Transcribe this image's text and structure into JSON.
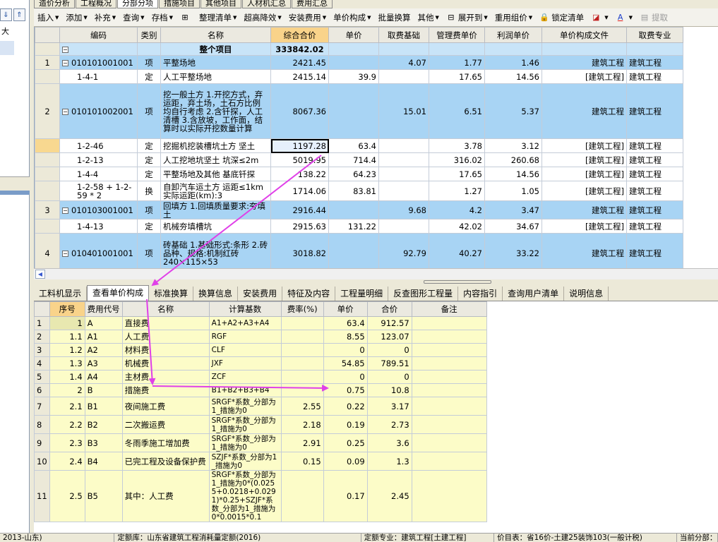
{
  "top_tabs": [
    "造价分析",
    "工程概况",
    "分部分项",
    "措施项目",
    "其他项目",
    "人材机汇总",
    "费用汇总"
  ],
  "left_panel": {
    "label": "大"
  },
  "toolbar": {
    "items": [
      {
        "label": "插入",
        "icon": "",
        "caret": true
      },
      {
        "label": "添加",
        "icon": "",
        "caret": true
      },
      {
        "label": "补充",
        "icon": "",
        "caret": true
      },
      {
        "label": "查询",
        "icon": "",
        "caret": true
      },
      {
        "label": "存档",
        "icon": "",
        "caret": true
      },
      {
        "label": "",
        "icon": "binoculars-icon",
        "caret": false
      },
      {
        "label": "整理清单",
        "icon": "",
        "caret": true
      },
      {
        "label": "超高降效",
        "icon": "",
        "caret": true
      },
      {
        "label": "安装费用",
        "icon": "",
        "caret": true
      },
      {
        "label": "单价构成",
        "icon": "",
        "caret": true
      },
      {
        "label": "批量换算",
        "icon": "",
        "caret": false
      },
      {
        "label": "其他",
        "icon": "",
        "caret": true
      },
      {
        "label": "展开到",
        "icon": "expand-icon",
        "caret": true
      },
      {
        "label": "重用组价",
        "icon": "",
        "caret": true
      },
      {
        "label": "锁定清单",
        "icon": "lock-icon",
        "caret": false
      },
      {
        "label": "",
        "icon": "fill-color-icon",
        "caret": true
      },
      {
        "label": "",
        "icon": "font-color-icon",
        "caret": true
      },
      {
        "label": "提取",
        "icon": "extract-icon",
        "caret": false
      }
    ]
  },
  "grid": {
    "columns": [
      "编码",
      "类别",
      "名称",
      "综合合价",
      "单价",
      "取费基础",
      "管理费单价",
      "利润单价",
      "单价构成文件",
      "取费专业"
    ],
    "project_row": {
      "name": "整个项目",
      "total": "333842.02"
    },
    "rows": [
      {
        "rn": "1",
        "kind": "list",
        "tree": "−",
        "code": "010101001001",
        "type": "项",
        "name": "平整场地",
        "total": "2421.45",
        "unit": "",
        "base": "4.07",
        "mgmt": "1.77",
        "profit": "1.46",
        "file": "建筑工程",
        "spec": "建筑工程"
      },
      {
        "rn": "",
        "kind": "quota",
        "tree": "",
        "code": "1-4-1",
        "type": "定",
        "name": "人工平整场地",
        "total": "2415.14",
        "unit": "39.9",
        "base": "",
        "mgmt": "17.65",
        "profit": "14.56",
        "file": "[建筑工程]",
        "spec": "建筑工程"
      },
      {
        "rn": "2",
        "kind": "list",
        "tree": "−",
        "code": "010101002001",
        "type": "项",
        "name": "挖一般土方\n1.开挖方式，弃运距，弃土场，土石方比例均自行考虑\n2.含钎探，人工清槽\n3.含放坡，工作面，结算时以实际开挖数量计算",
        "total": "8067.36",
        "unit": "",
        "base": "15.01",
        "mgmt": "6.51",
        "profit": "5.37",
        "file": "建筑工程",
        "spec": "建筑工程"
      },
      {
        "rn": "",
        "kind": "quota",
        "tree": "",
        "code": "1-2-46",
        "type": "定",
        "name": "挖掘机挖装槽坑土方 坚土",
        "total": "1197.28",
        "unit": "63.4",
        "base": "",
        "mgmt": "3.78",
        "profit": "3.12",
        "file": "[建筑工程]",
        "spec": "建筑工程",
        "selected": true
      },
      {
        "rn": "",
        "kind": "quota",
        "tree": "",
        "code": "1-2-13",
        "type": "定",
        "name": "人工挖地坑坚土 坑深≤2m",
        "total": "5019.95",
        "unit": "714.4",
        "base": "",
        "mgmt": "316.02",
        "profit": "260.68",
        "file": "[建筑工程]",
        "spec": "建筑工程"
      },
      {
        "rn": "",
        "kind": "quota",
        "tree": "",
        "code": "1-4-4",
        "type": "定",
        "name": "平整场地及其他 基底钎探",
        "total": "138.22",
        "unit": "64.23",
        "base": "",
        "mgmt": "17.65",
        "profit": "14.56",
        "file": "[建筑工程]",
        "spec": "建筑工程"
      },
      {
        "rn": "",
        "kind": "quota",
        "tree": "",
        "code": "1-2-58 + 1-2-59 * 2",
        "type": "换",
        "name": "自卸汽车运土方 运距≤1km 实际运距(km):3",
        "total": "1714.06",
        "unit": "83.81",
        "base": "",
        "mgmt": "1.27",
        "profit": "1.05",
        "file": "[建筑工程]",
        "spec": "建筑工程"
      },
      {
        "rn": "3",
        "kind": "list",
        "tree": "−",
        "code": "010103001001",
        "type": "项",
        "name": "回填方\n1.回填质量要求:夯填土",
        "total": "2916.44",
        "unit": "",
        "base": "9.68",
        "mgmt": "4.2",
        "profit": "3.47",
        "file": "建筑工程",
        "spec": "建筑工程"
      },
      {
        "rn": "",
        "kind": "quota",
        "tree": "",
        "code": "1-4-13",
        "type": "定",
        "name": "机械夯填槽坑",
        "total": "2915.63",
        "unit": "131.22",
        "base": "",
        "mgmt": "42.02",
        "profit": "34.67",
        "file": "[建筑工程]",
        "spec": "建筑工程"
      },
      {
        "rn": "4",
        "kind": "list",
        "tree": "−",
        "code": "010401001001",
        "type": "项",
        "name": "砖基础\n1.基础形式:条形\n2.砖品种、规格:机制红砖 240×115×53",
        "total": "3018.82",
        "unit": "",
        "base": "92.79",
        "mgmt": "40.27",
        "profit": "33.22",
        "file": "建筑工程",
        "spec": "建筑工程"
      }
    ]
  },
  "bottom_tabs": [
    "工料机显示",
    "查看单价构成",
    "标准换算",
    "换算信息",
    "安装费用",
    "特征及内容",
    "工程量明细",
    "反查图形工程量",
    "内容指引",
    "查询用户清单",
    "说明信息"
  ],
  "bottom_active": 1,
  "sub_table": {
    "columns": [
      "序号",
      "费用代号",
      "名称",
      "计算基数",
      "费率(%)",
      "单价",
      "合价",
      "备注"
    ],
    "rows": [
      {
        "rn": "1",
        "seq": "1",
        "code": "A",
        "name": "直接费",
        "base": "A1+A2+A3+A4",
        "rate": "",
        "unit": "63.4",
        "total": "912.57",
        "note": ""
      },
      {
        "rn": "2",
        "seq": "1.1",
        "code": "A1",
        "name": "人工费",
        "base": "RGF",
        "rate": "",
        "unit": "8.55",
        "total": "123.07",
        "note": ""
      },
      {
        "rn": "3",
        "seq": "1.2",
        "code": "A2",
        "name": "材料费",
        "base": "CLF",
        "rate": "",
        "unit": "0",
        "total": "0",
        "note": ""
      },
      {
        "rn": "4",
        "seq": "1.3",
        "code": "A3",
        "name": "机械费",
        "base": "JXF",
        "rate": "",
        "unit": "54.85",
        "total": "789.51",
        "note": ""
      },
      {
        "rn": "5",
        "seq": "1.4",
        "code": "A4",
        "name": "主材费",
        "base": "ZCF",
        "rate": "",
        "unit": "0",
        "total": "0",
        "note": ""
      },
      {
        "rn": "6",
        "seq": "2",
        "code": "B",
        "name": "措施费",
        "base": "B1+B2+B3+B4",
        "rate": "",
        "unit": "0.75",
        "total": "10.8",
        "note": ""
      },
      {
        "rn": "7",
        "seq": "2.1",
        "code": "B1",
        "name": "夜间施工费",
        "base": "SRGF*系数_分部为1_措施为0",
        "rate": "2.55",
        "unit": "0.22",
        "total": "3.17",
        "note": ""
      },
      {
        "rn": "8",
        "seq": "2.2",
        "code": "B2",
        "name": "二次搬运费",
        "base": "SRGF*系数_分部为1_措施为0",
        "rate": "2.18",
        "unit": "0.19",
        "total": "2.73",
        "note": ""
      },
      {
        "rn": "9",
        "seq": "2.3",
        "code": "B3",
        "name": "冬雨季施工增加费",
        "base": "SRGF*系数_分部为1_措施为0",
        "rate": "2.91",
        "unit": "0.25",
        "total": "3.6",
        "note": ""
      },
      {
        "rn": "10",
        "seq": "2.4",
        "code": "B4",
        "name": "已完工程及设备保护费",
        "base": "SZJF*系数_分部为1_措施为0",
        "rate": "0.15",
        "unit": "0.09",
        "total": "1.3",
        "note": ""
      },
      {
        "rn": "11",
        "seq": "2.5",
        "code": "B5",
        "name": "其中：人工费",
        "base": "SRGF*系数_分部为1_措施为0*(0.0255+0.0218+0.0291)*0.25+SZJF*系数_分部为1_措施为0*0.0015*0.1",
        "rate": "",
        "unit": "0.17",
        "total": "2.45",
        "note": ""
      }
    ]
  },
  "status": [
    "2013-山东)",
    "定额库：山东省建筑工程消耗量定额(2016)",
    "定额专业：建筑工程[土建工程]",
    "价目表：省16价-土建25装饰103(一般计税)",
    "当前分部："
  ],
  "annotation_color": "#e040e8"
}
